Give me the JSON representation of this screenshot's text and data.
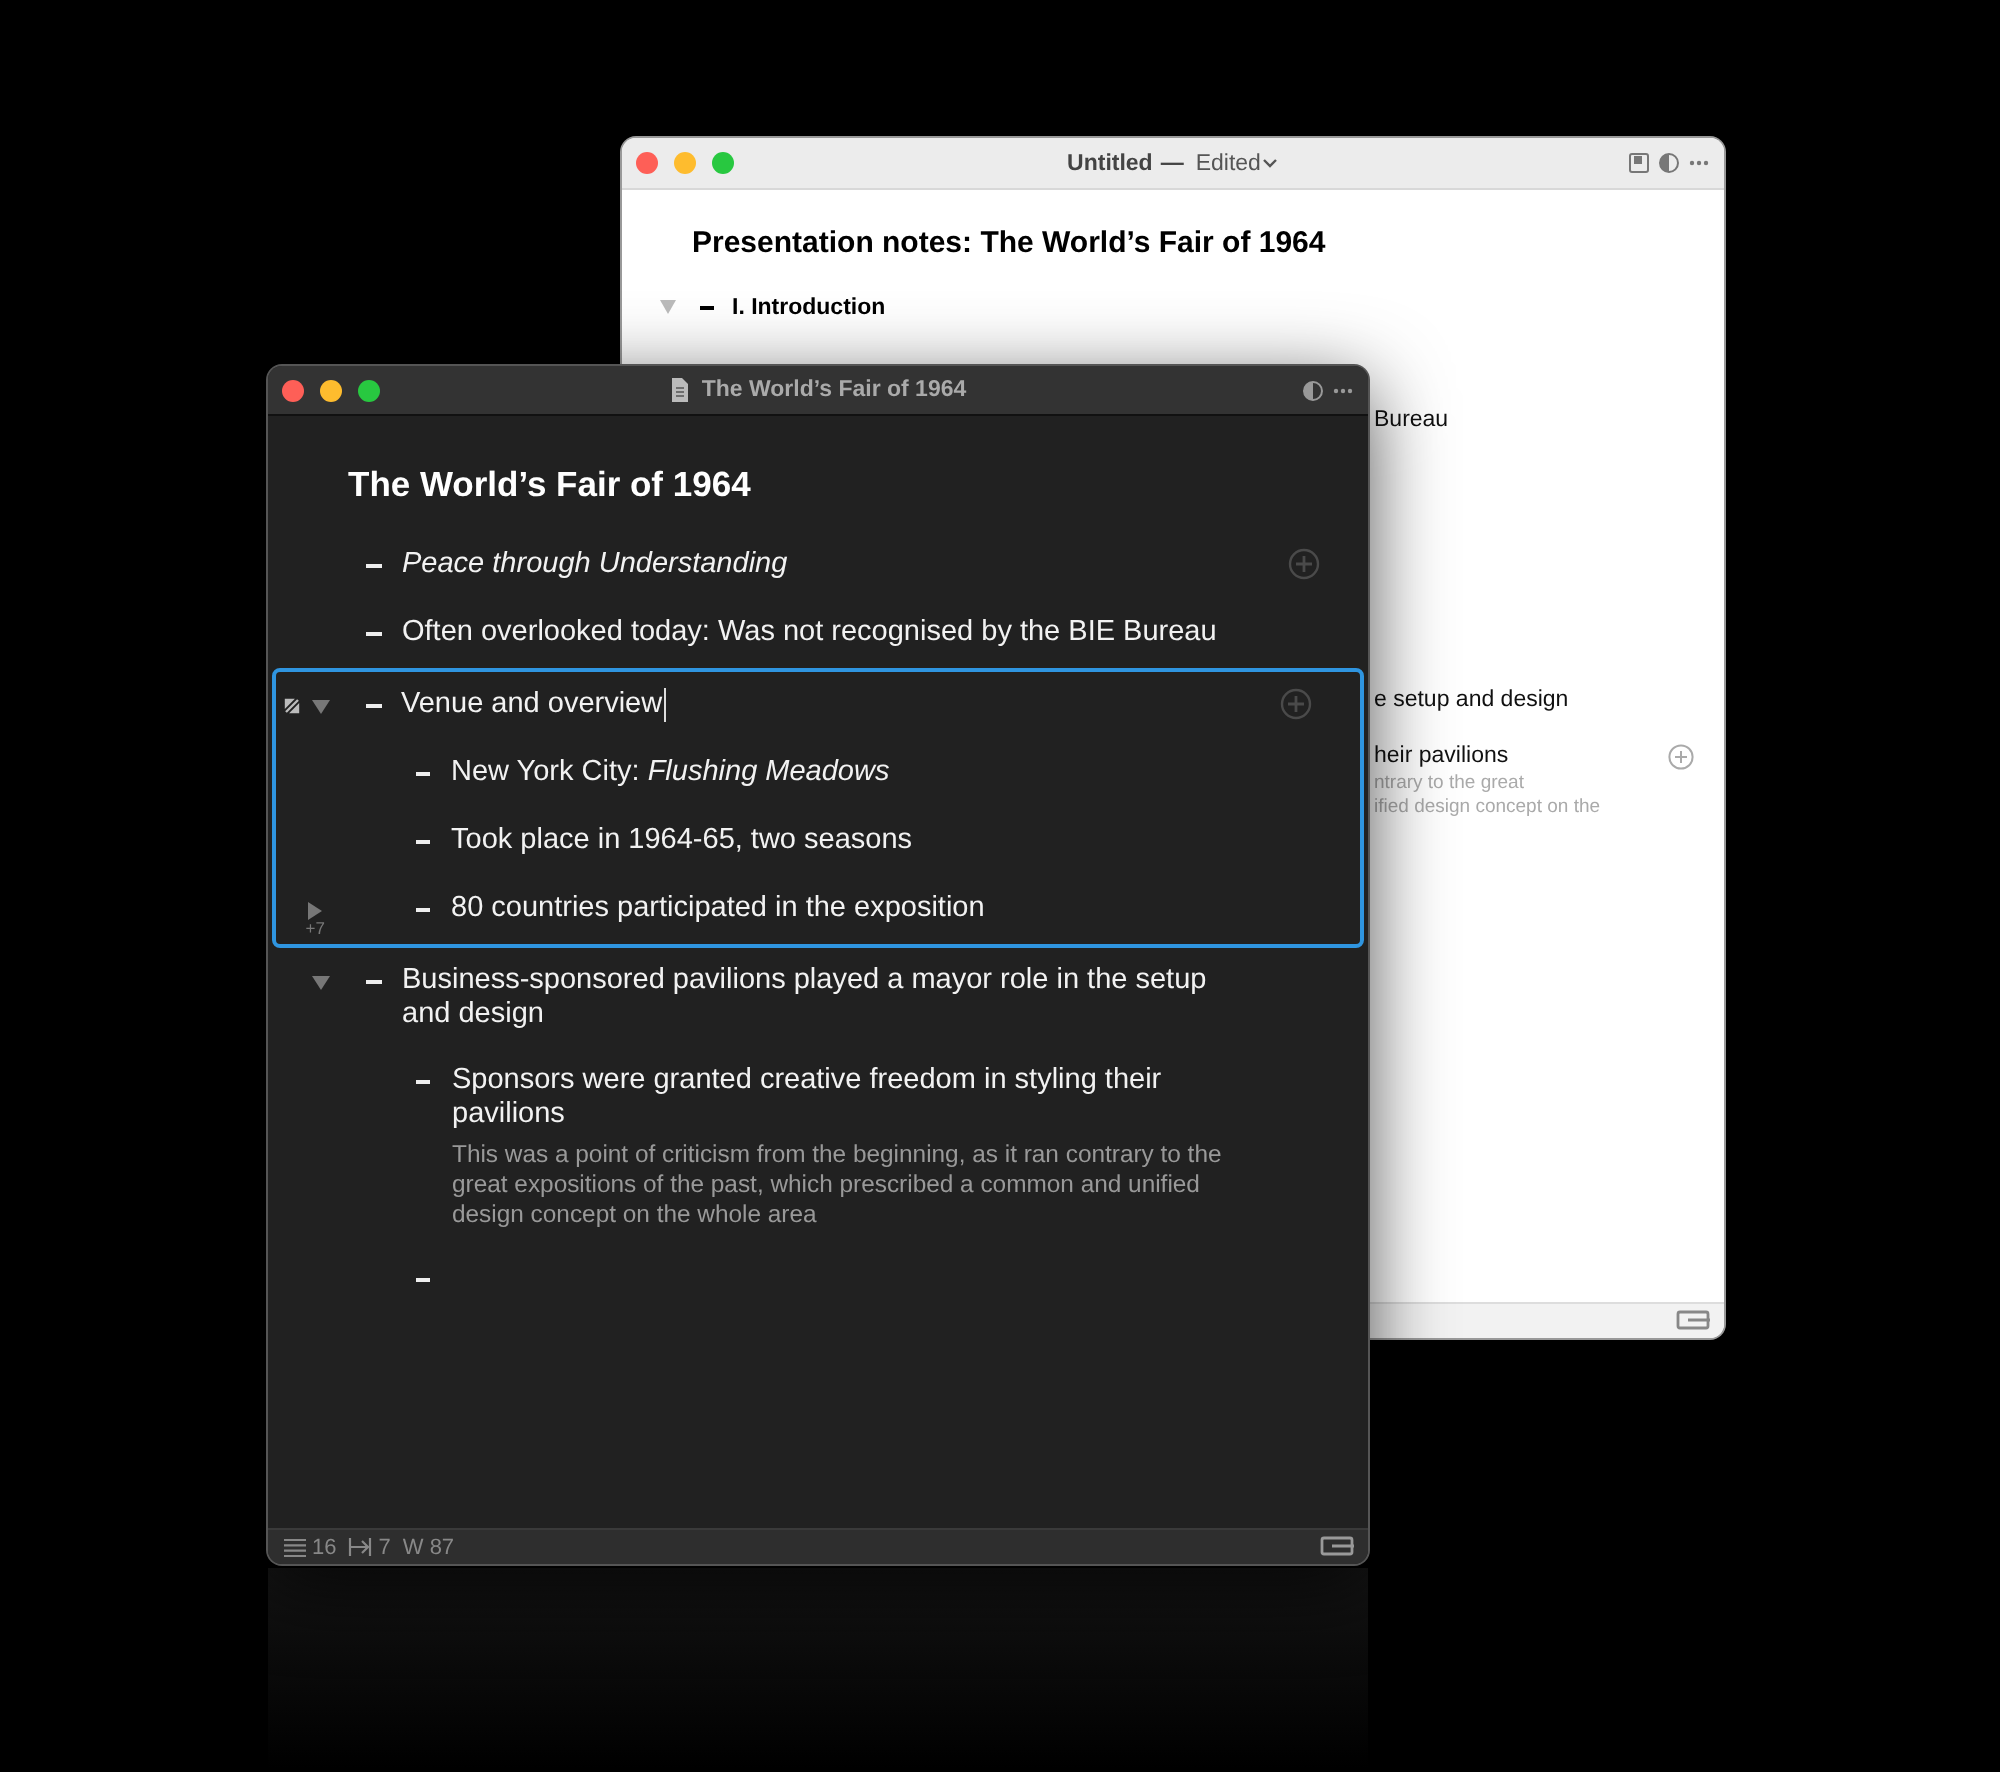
{
  "back_window": {
    "title": "Untitled",
    "title_separator": "—",
    "status": "Edited",
    "heading": "Presentation notes: The World’s Fair of 1964",
    "items": [
      {
        "text": "I. Introduction",
        "expanded": true
      }
    ],
    "fragments": [
      {
        "kind": "line",
        "text": "Bureau",
        "add_button": false
      },
      {
        "kind": "line",
        "text": "e setup and design",
        "add_button": false
      },
      {
        "kind": "line",
        "text": "heir pavilions",
        "add_button": true
      },
      {
        "kind": "note",
        "text": "ntrary to the great"
      },
      {
        "kind": "note",
        "text": "ified design concept on the"
      }
    ]
  },
  "front_window": {
    "title": "The World’s Fair of 1964",
    "heading": "The World’s Fair of 1964",
    "items": [
      {
        "kind": "text",
        "text": "Peace through Understanding",
        "italic": true,
        "add_button": true,
        "focused": false
      },
      {
        "kind": "text",
        "text": "Often overlooked today: Was not recognised by the BIE Bureau",
        "italic": false,
        "add_button": false,
        "focused": false
      },
      {
        "kind": "text",
        "text": "Venue and overview",
        "italic": false,
        "add_button": true,
        "focused": true,
        "cursor": true,
        "expanded": true,
        "children": [
          {
            "kind": "text",
            "text": "New York City: *Flushing Meadows*",
            "italic": false,
            "add_button": false,
            "focused": false
          },
          {
            "kind": "text",
            "text": "Took place in 1964-65, two seasons",
            "italic": false,
            "add_button": false,
            "focused": false
          },
          {
            "kind": "text",
            "text": "80 countries participated in the exposition",
            "italic": false,
            "add_button": false,
            "focused": false,
            "expanded": false,
            "hidden_count": "+7"
          }
        ]
      },
      {
        "kind": "text",
        "text": "Business-sponsored pavilions played a mayor role in the setup and design",
        "italic": false,
        "add_button": false,
        "focused": false,
        "expanded": true,
        "children": [
          {
            "kind": "text",
            "text": "Sponsors were granted creative freedom in styling their pavilions",
            "italic": false,
            "add_button": false,
            "focused": false,
            "note": "This was a point of criticism from the beginning, as it ran contrary to the great expositions of the past, which prescribed a common and unified design concept on the whole area"
          },
          {
            "kind": "empty",
            "focused": false
          }
        ]
      }
    ],
    "status_bar": {
      "lines": "16",
      "tabs": "7",
      "words": "W 87"
    }
  }
}
